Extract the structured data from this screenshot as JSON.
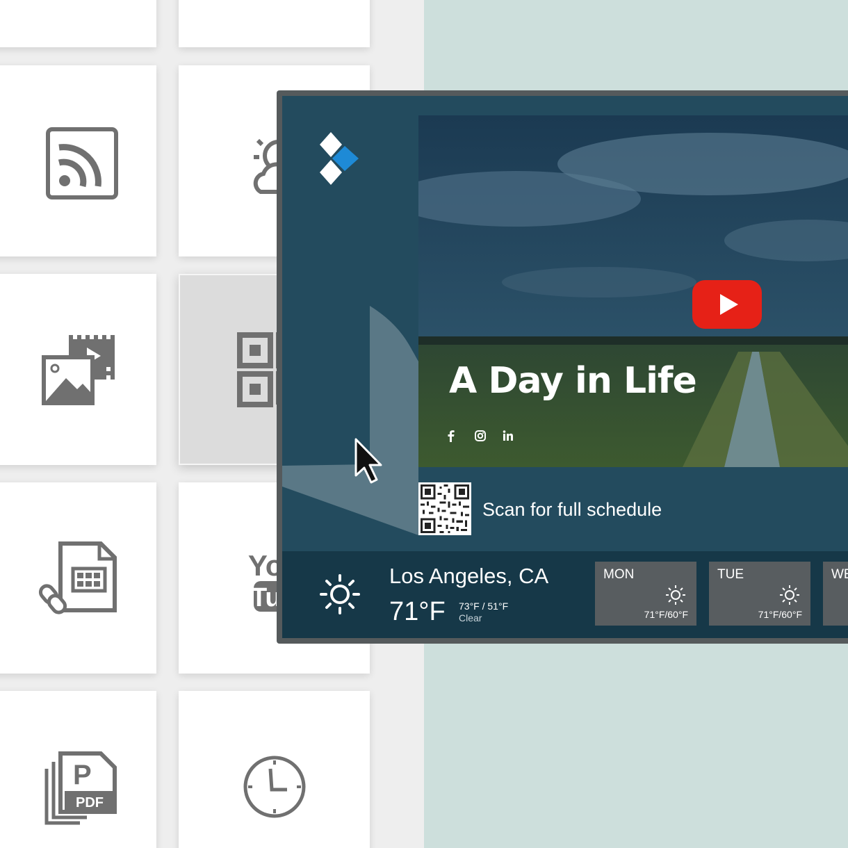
{
  "widgets": [
    {
      "icon": "rss-feed-icon"
    },
    {
      "icon": "weather-icon"
    },
    {
      "icon": "media-slideshow-icon"
    },
    {
      "icon": "qr-code-icon"
    },
    {
      "icon": "spreadsheet-link-icon"
    },
    {
      "icon": "youtube-icon"
    },
    {
      "icon": "pdf-icon",
      "label": "PDF"
    },
    {
      "icon": "clock-icon"
    }
  ],
  "youtube_icon_text": "YouTube",
  "pdf_logo_letter": "P",
  "display": {
    "logo": "brand-logo",
    "video": {
      "title": "A Day in Life",
      "socials": [
        "facebook-icon",
        "instagram-icon",
        "linkedin-icon"
      ]
    },
    "qr": {
      "caption": "Scan for full schedule"
    },
    "weather": {
      "city": "Los Angeles, CA",
      "temp": "71°F",
      "hilo": "73°F / 51°F",
      "condition": "Clear",
      "forecast": [
        {
          "day": "MON",
          "temp": "71°F/60°F"
        },
        {
          "day": "TUE",
          "temp": "71°F/60°F"
        },
        {
          "day": "WED",
          "temp": ""
        }
      ]
    }
  },
  "colors": {
    "background": "#cddfdc",
    "screen": "#234b5e",
    "weather_bar": "#163848",
    "icon_gray": "#707070",
    "youtube_red": "#e62117"
  }
}
